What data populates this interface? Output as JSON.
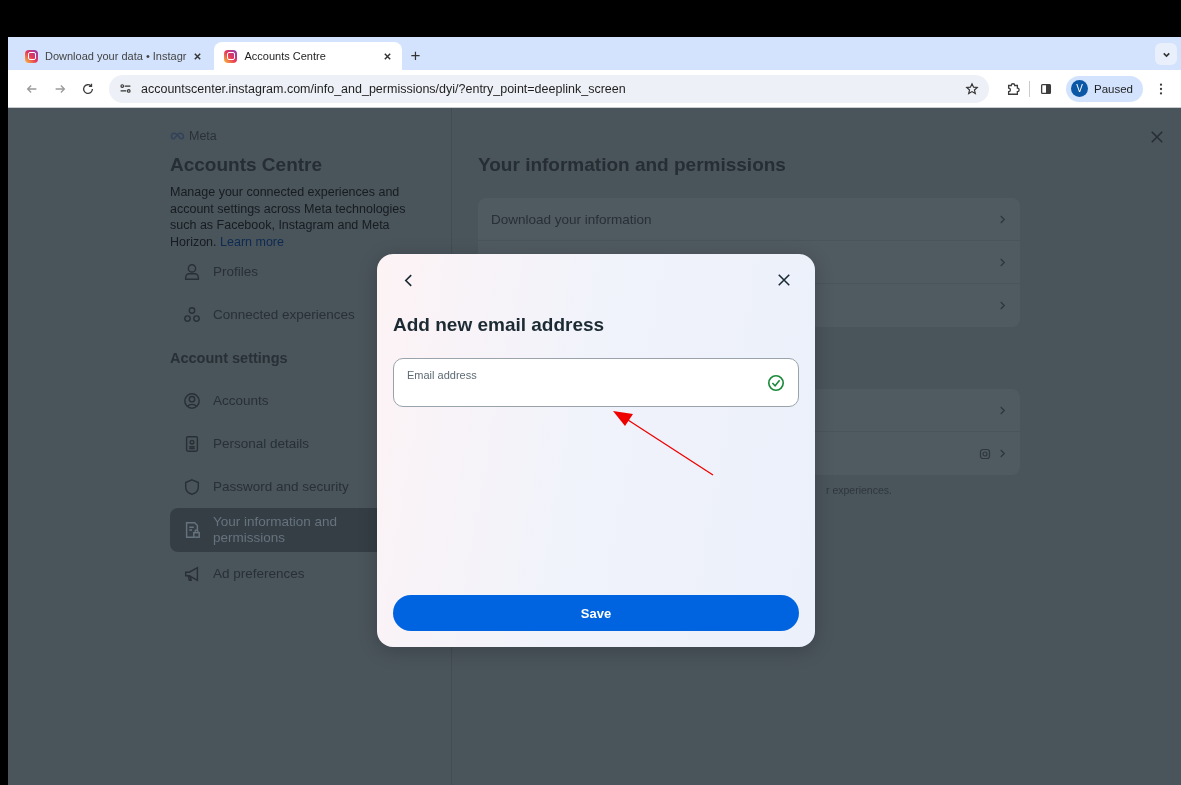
{
  "browser": {
    "tabs": [
      {
        "title": "Download your data • Instagr",
        "selected": false
      },
      {
        "title": "Accounts Centre",
        "selected": true
      }
    ],
    "new_tab": "+",
    "url": "accountscenter.instagram.com/info_and_permissions/dyi/?entry_point=deeplink_screen",
    "profile": {
      "initial": "V",
      "status": "Paused"
    }
  },
  "sidebar": {
    "brand": "Meta",
    "title": "Accounts Centre",
    "description": "Manage your connected experiences and account settings across Meta technologies such as Facebook, Instagram and Meta Horizon.",
    "learn_more": "Learn more",
    "items": [
      {
        "label": "Profiles",
        "selected": false
      },
      {
        "label": "Connected experiences",
        "selected": false
      }
    ],
    "section_title": "Account settings",
    "section_items": [
      {
        "label": "Accounts",
        "selected": false
      },
      {
        "label": "Personal details",
        "selected": false
      },
      {
        "label": "Password and security",
        "selected": false
      },
      {
        "label": "Your information and permissions",
        "selected": true
      },
      {
        "label": "Ad preferences",
        "selected": false
      }
    ]
  },
  "main": {
    "heading": "Your information and permissions",
    "groups": [
      {
        "rows": [
          {
            "label": "Download your information"
          },
          {},
          {}
        ]
      },
      {
        "rows": [
          {},
          {
            "badge": true
          }
        ]
      }
    ],
    "footnote": "r experiences."
  },
  "modal": {
    "title": "Add new email address",
    "field": {
      "label": "Email address",
      "valid": true
    },
    "save": "Save"
  }
}
